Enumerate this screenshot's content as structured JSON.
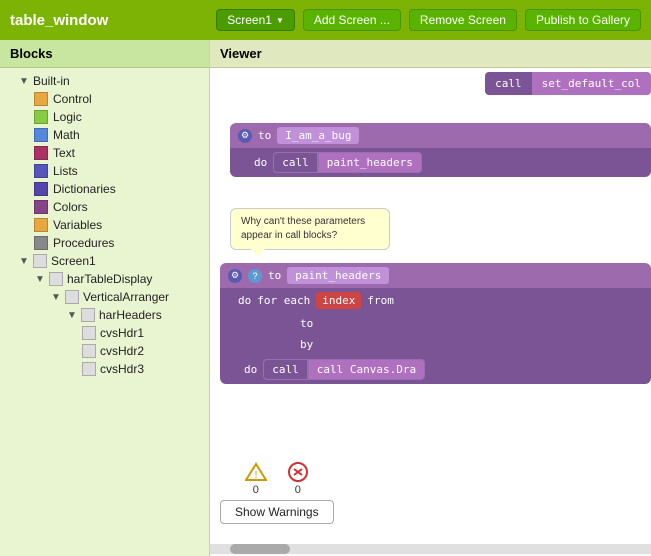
{
  "titleBar": {
    "appTitle": "table_window",
    "screenDropdown": "Screen1",
    "dropdownArrow": "▼",
    "addScreenLabel": "Add Screen ...",
    "removeScreenLabel": "Remove Screen",
    "publishLabel": "Publish to Gallery"
  },
  "sidebar": {
    "header": "Blocks",
    "tree": {
      "builtIn": "Built-in",
      "control": "Control",
      "logic": "Logic",
      "math": "Math",
      "text": "Text",
      "lists": "Lists",
      "dictionaries": "Dictionaries",
      "colors": "Colors",
      "variables": "Variables",
      "procedures": "Procedures",
      "screen1": "Screen1",
      "harTableDisplay": "harTableDisplay",
      "verticalArranger": "VerticalArranger",
      "harHeaders": "harHeaders",
      "cvsHdr1": "cvsHdr1",
      "cvsHdr2": "cvsHdr2",
      "cvsHdr3": "cvsHdr3"
    }
  },
  "viewer": {
    "header": "Viewer"
  },
  "warningsPanel": {
    "warningCount": "0",
    "errorCount": "0",
    "showWarningsLabel": "Show Warnings"
  },
  "blocks": {
    "callSetDefaultCol": "set_default_col",
    "toIAmABug": "I_am_a_bug",
    "callPaintHeaders": "paint_headers",
    "tooltipText": "Why can't these parameters appear in call blocks?",
    "toPaintHeaders": "paint_headers",
    "forEach": "for each",
    "index": "index",
    "from": "from",
    "to": "to",
    "by": "by",
    "doCallCanvas": "call Canvas.Dra",
    "doLabel": "do",
    "callLabel": "call"
  }
}
